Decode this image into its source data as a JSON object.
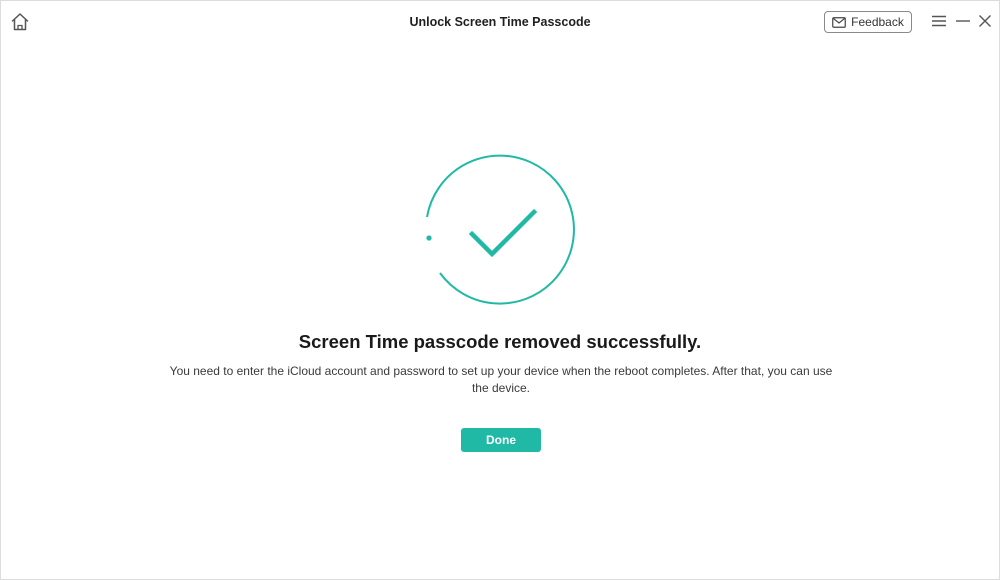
{
  "window": {
    "title": "Unlock Screen Time Passcode"
  },
  "toolbar": {
    "home_icon": "home-icon",
    "feedback_label": "Feedback",
    "feedback_icon": "mail-icon",
    "menu_icon": "menu-icon",
    "minimize_icon": "minimize-icon",
    "close_icon": "close-icon"
  },
  "result": {
    "icon": "success-check-icon",
    "accent_color": "#1fb9a6",
    "headline": "Screen Time passcode removed successfully.",
    "message": "You need to enter the iCloud account and password to set up your device when the reboot completes. After that, you can use the device.",
    "done_label": "Done"
  }
}
